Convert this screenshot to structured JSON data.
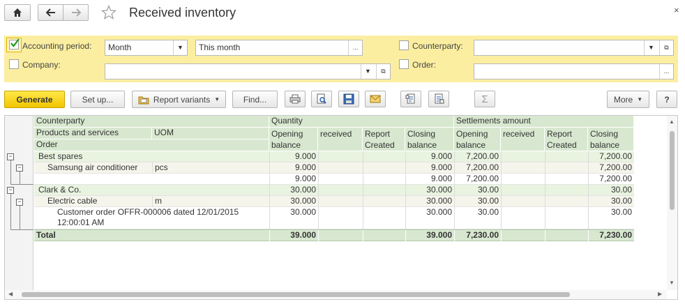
{
  "window": {
    "title": "Received inventory"
  },
  "filters": {
    "accounting_period_label": "Accounting period:",
    "period_type": "Month",
    "period_value": "This month",
    "company_label": "Company:",
    "company_value": "",
    "counterparty_label": "Counterparty:",
    "counterparty_value": "",
    "order_label": "Order:",
    "order_value": ""
  },
  "toolbar": {
    "generate": "Generate",
    "setup": "Set up...",
    "report_variants": "Report variants",
    "find": "Find...",
    "more": "More",
    "help": "?",
    "sum": "Σ",
    "ellipsis": "..."
  },
  "table": {
    "headers": {
      "counterparty": "Counterparty",
      "products": "Products and services",
      "uom": "UOM",
      "order": "Order",
      "quantity": "Quantity",
      "settlements": "Settlements amount",
      "opening": "Opening",
      "balance": "balance",
      "received": "received",
      "report": "Report",
      "created": "Created",
      "closing": "Closing"
    },
    "rows": [
      {
        "name": "Best spares",
        "uom": "",
        "q_open": "9.000",
        "q_recv": "",
        "q_rep": "",
        "q_close": "9.000",
        "s_open": "7,200.00",
        "s_recv": "",
        "s_rep": "",
        "s_close": "7,200.00"
      },
      {
        "name": "Samsung air conditioner",
        "uom": "pcs",
        "q_open": "9.000",
        "q_recv": "",
        "q_rep": "",
        "q_close": "9.000",
        "s_open": "7,200.00",
        "s_recv": "",
        "s_rep": "",
        "s_close": "7,200.00"
      },
      {
        "name": "",
        "uom": "",
        "q_open": "9.000",
        "q_recv": "",
        "q_rep": "",
        "q_close": "9.000",
        "s_open": "7,200.00",
        "s_recv": "",
        "s_rep": "",
        "s_close": "7,200.00"
      },
      {
        "name": "Clark & Co.",
        "uom": "",
        "q_open": "30.000",
        "q_recv": "",
        "q_rep": "",
        "q_close": "30.000",
        "s_open": "30.00",
        "s_recv": "",
        "s_rep": "",
        "s_close": "30.00"
      },
      {
        "name": "Electric cable",
        "uom": "m",
        "q_open": "30.000",
        "q_recv": "",
        "q_rep": "",
        "q_close": "30.000",
        "s_open": "30.00",
        "s_recv": "",
        "s_rep": "",
        "s_close": "30.00"
      },
      {
        "name": "Customer order OFFR-000006 dated 12/01/2015",
        "name2": "12:00:01 AM",
        "uom": "",
        "q_open": "30.000",
        "q_recv": "",
        "q_rep": "",
        "q_close": "30.000",
        "s_open": "30.00",
        "s_recv": "",
        "s_rep": "",
        "s_close": "30.00"
      }
    ],
    "total": {
      "name": "Total",
      "q_open": "39.000",
      "q_close": "39.000",
      "s_open": "7,230.00",
      "s_close": "7,230.00"
    }
  }
}
